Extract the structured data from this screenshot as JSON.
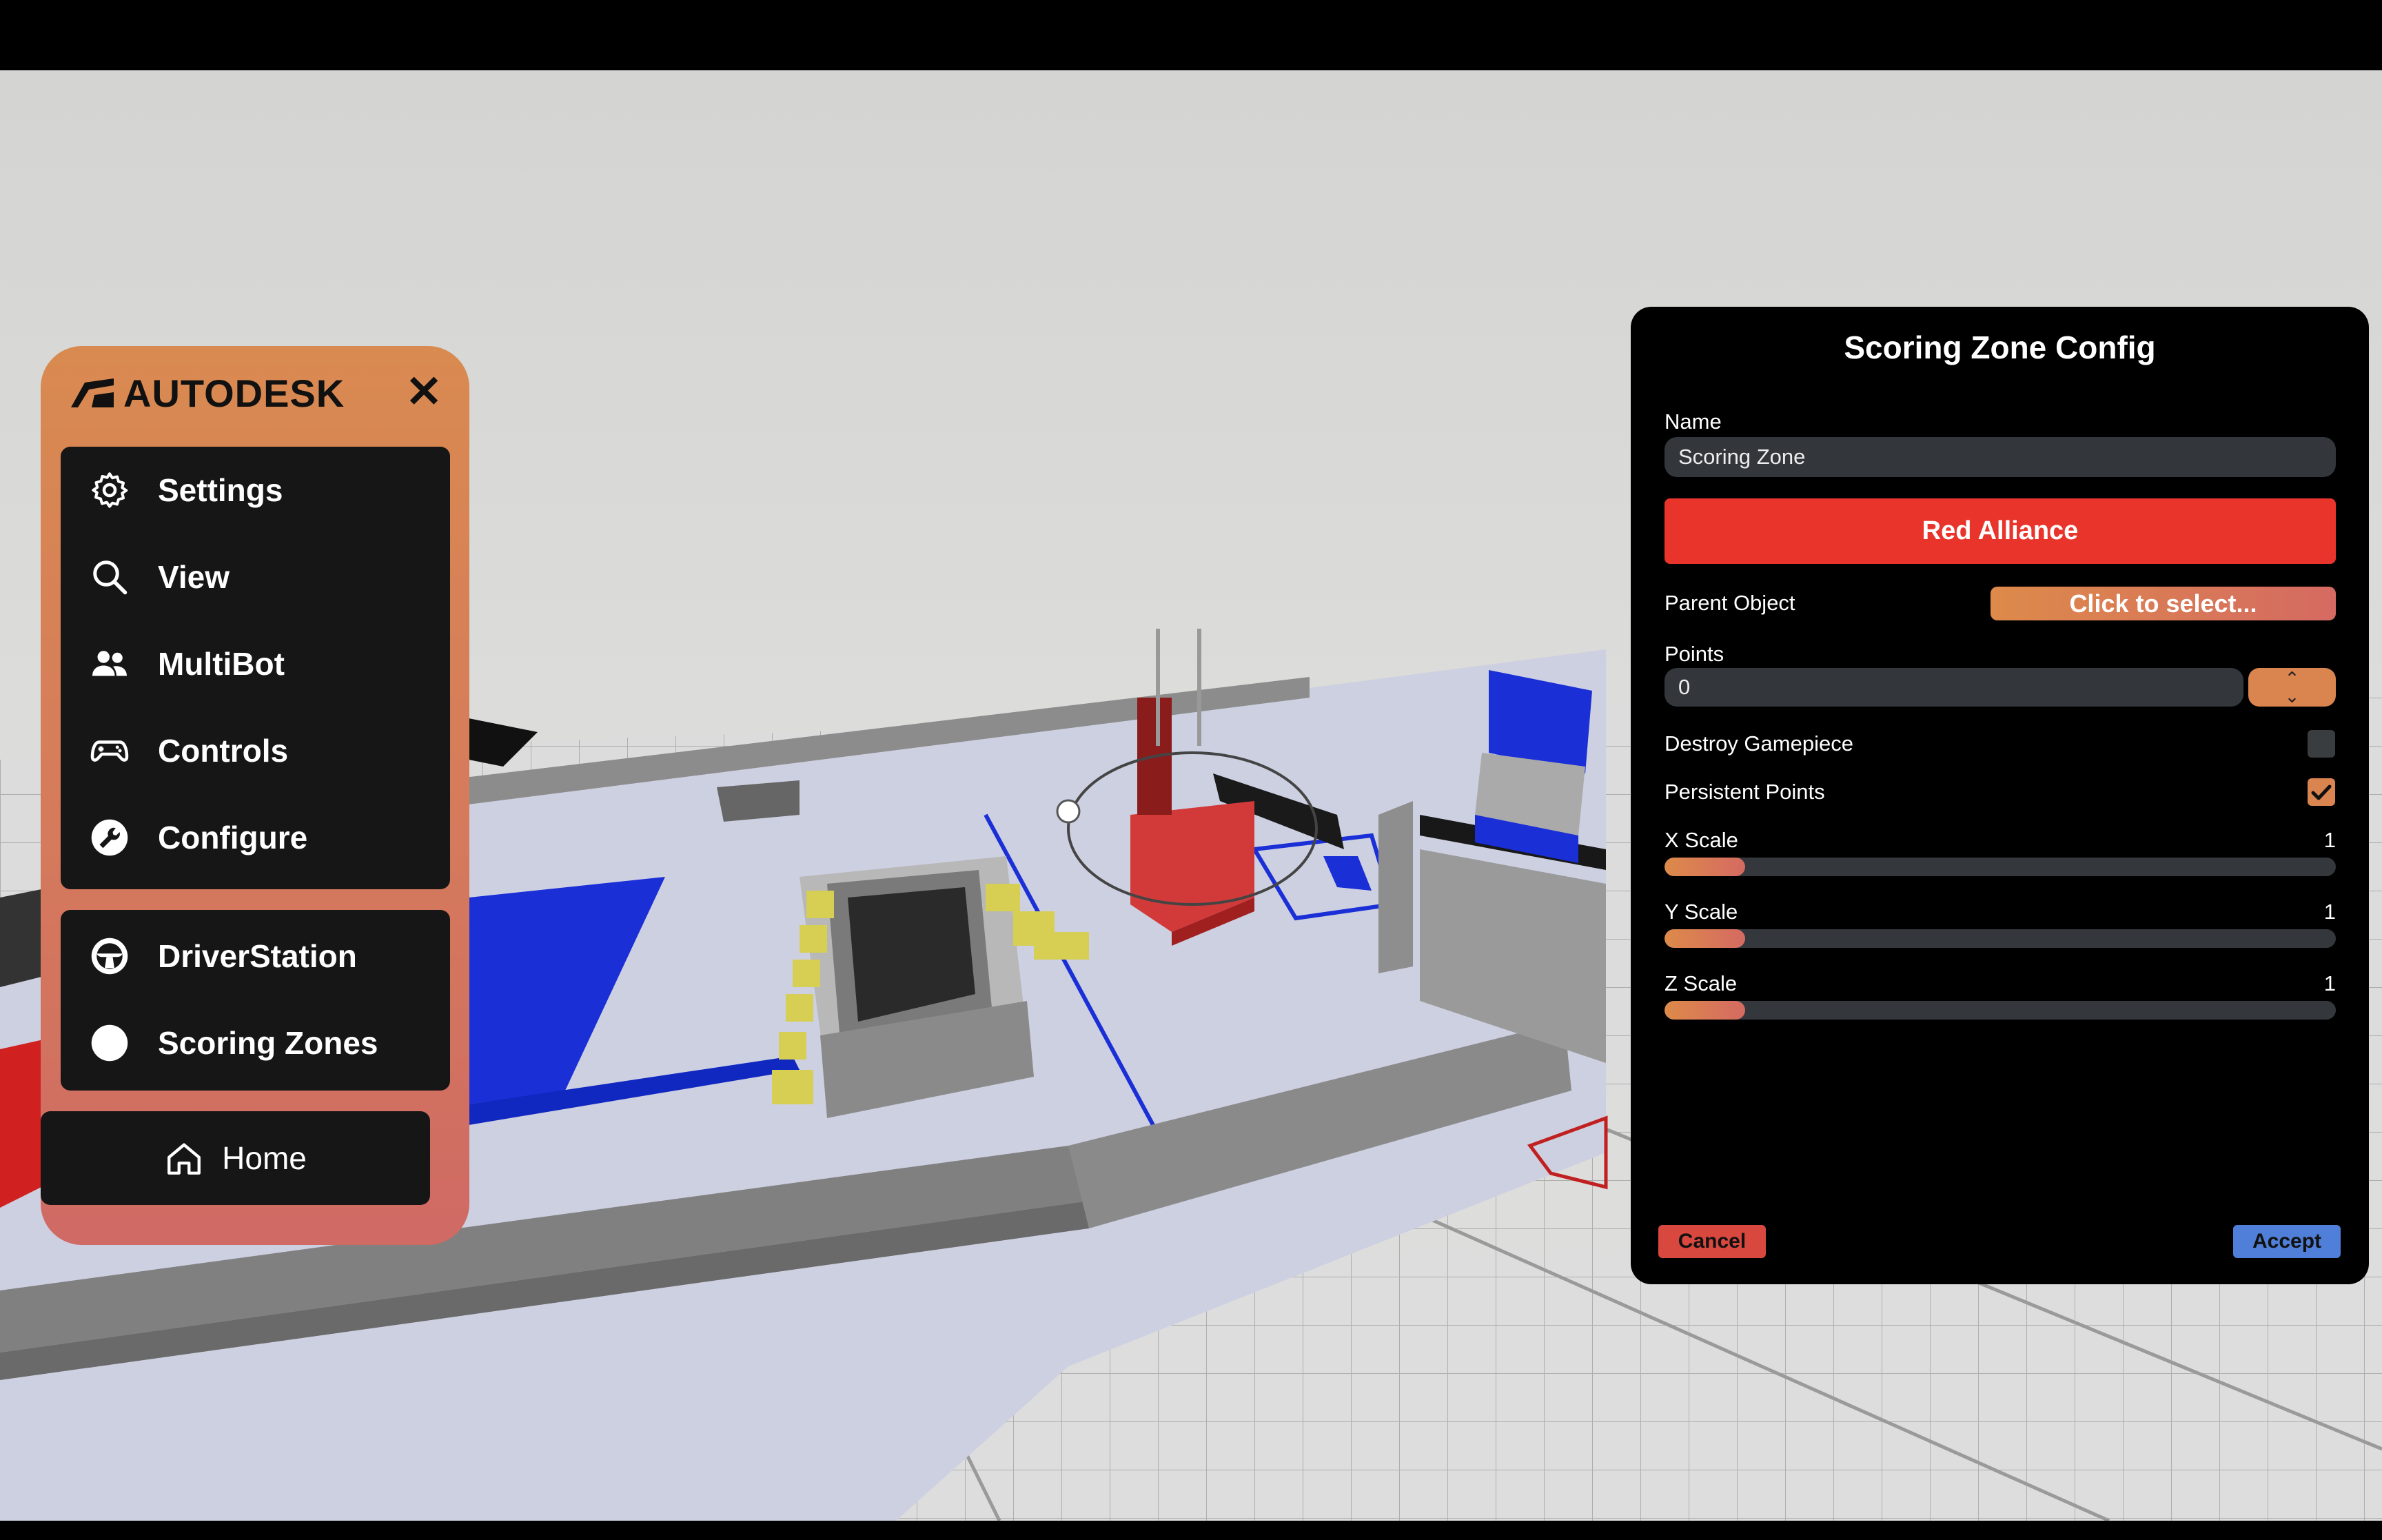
{
  "menu": {
    "brand": "AUTODESK",
    "close_icon": "close-icon",
    "primary_items": [
      {
        "label": "Settings",
        "icon": "gear-icon"
      },
      {
        "label": "View",
        "icon": "search-icon"
      },
      {
        "label": "MultiBot",
        "icon": "users-icon"
      },
      {
        "label": "Controls",
        "icon": "gamepad-icon"
      },
      {
        "label": "Configure",
        "icon": "wrench-icon"
      }
    ],
    "secondary_items": [
      {
        "label": "DriverStation",
        "icon": "steering-wheel-icon"
      },
      {
        "label": "Scoring Zones",
        "icon": "circle-icon"
      }
    ],
    "home": {
      "label": "Home",
      "icon": "home-icon"
    },
    "colors": {
      "gradient_top": "#d98a50",
      "gradient_bottom": "#cf6a64",
      "item_bg": "#161616"
    }
  },
  "panel": {
    "title": "Scoring Zone Config",
    "name_label": "Name",
    "name_value": "Scoring Zone",
    "alliance_button": "Red Alliance",
    "parent_label": "Parent Object",
    "parent_button": "Click to select...",
    "points_label": "Points",
    "points_value": "0",
    "destroy_label": "Destroy Gamepiece",
    "destroy_checked": false,
    "persistent_label": "Persistent Points",
    "persistent_checked": true,
    "x_scale_label": "X Scale",
    "x_scale_value": "1",
    "y_scale_label": "Y Scale",
    "y_scale_value": "1",
    "z_scale_label": "Z Scale",
    "z_scale_value": "1",
    "slider_fraction": 0.12,
    "cancel_label": "Cancel",
    "accept_label": "Accept",
    "colors": {
      "alliance": "#e8342a",
      "accent": "#da844f",
      "accept": "#4f7fd8",
      "cancel": "#d9483f"
    }
  }
}
